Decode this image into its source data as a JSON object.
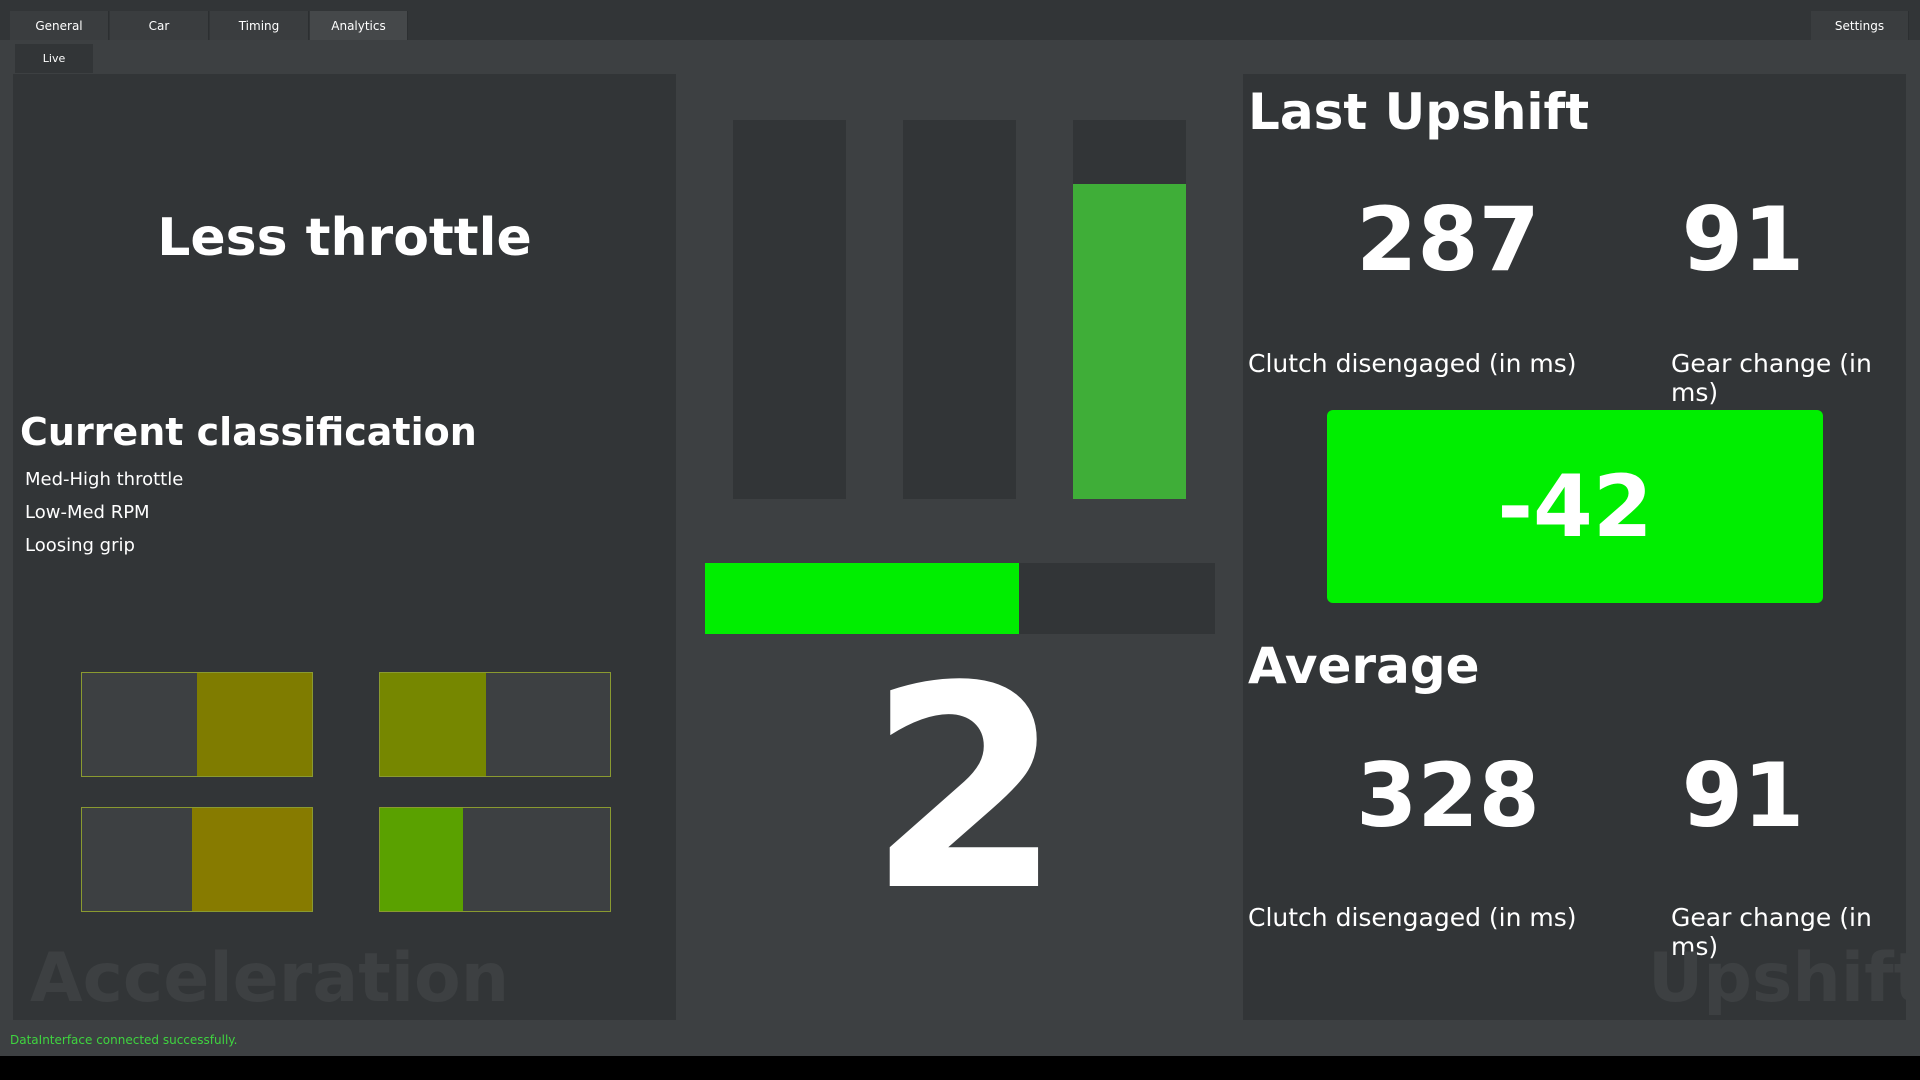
{
  "tabs": [
    {
      "label": "General"
    },
    {
      "label": "Car"
    },
    {
      "label": "Timing"
    },
    {
      "label": "Analytics"
    }
  ],
  "settings_label": "Settings",
  "subtab": {
    "label": "Live"
  },
  "acceleration": {
    "recommendation": "Less throttle",
    "classification_title": "Current classification",
    "classification_items": [
      "Med-High throttle",
      "Low-Med RPM",
      "Loosing grip"
    ],
    "watermark": "Acceleration",
    "quadrants": [
      {
        "fill_side": "right",
        "fill_fraction": 0.5,
        "color": "#7f7c00"
      },
      {
        "fill_side": "left",
        "fill_fraction": 0.46,
        "color": "#768700"
      },
      {
        "fill_side": "right",
        "fill_fraction": 0.52,
        "color": "#877b00"
      },
      {
        "fill_side": "left",
        "fill_fraction": 0.36,
        "color": "#5aa100"
      }
    ]
  },
  "center": {
    "vertical_meters": [
      {
        "level": 0.0,
        "color": "#3fae38"
      },
      {
        "level": 0.0,
        "color": "#3fae38"
      },
      {
        "level": 0.83,
        "color": "#3fae38"
      }
    ],
    "horizontal_bar": {
      "level": 0.615,
      "color": "#00ee00"
    },
    "gear": "2"
  },
  "upshift": {
    "last_title": "Last Upshift",
    "last_clutch": "287",
    "last_gear": "91",
    "clutch_label": "Clutch disengaged (in ms)",
    "gear_label": "Gear change (in ms)",
    "delta": "-42",
    "delta_color": "#00ee00",
    "average_title": "Average",
    "avg_clutch": "328",
    "avg_gear": "91",
    "watermark": "Upshift"
  },
  "status": {
    "message": "DataInterface connected successfully.",
    "color": "#3fd43f"
  }
}
